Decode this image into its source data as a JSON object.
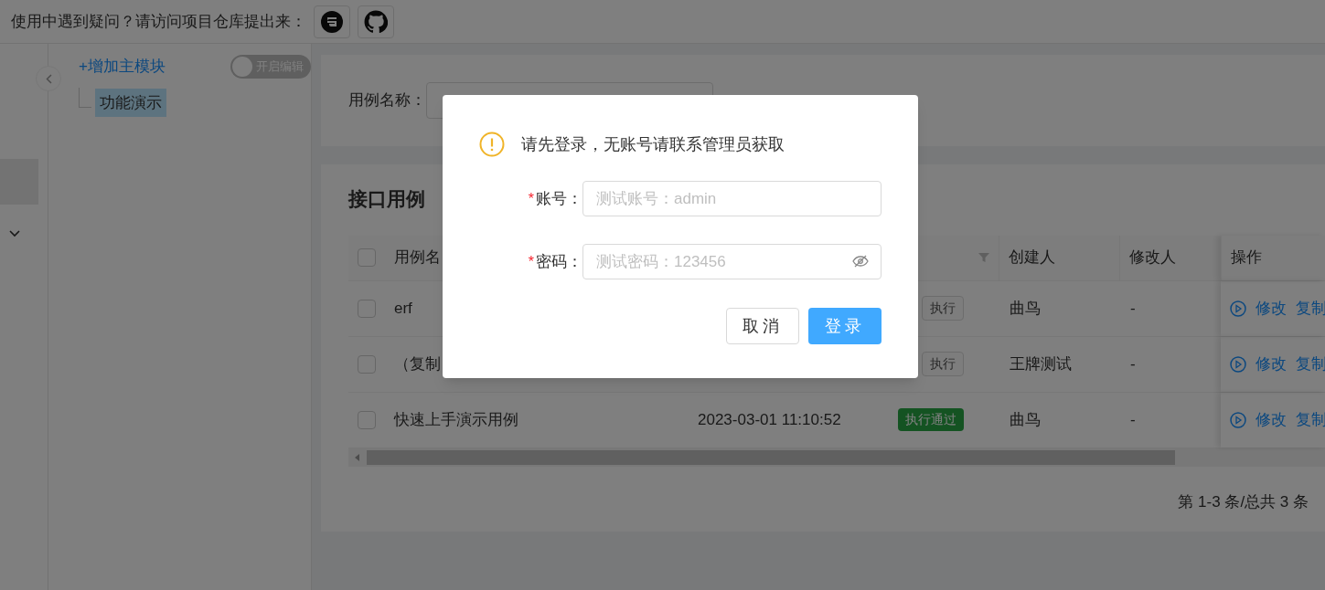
{
  "header": {
    "text": "使用中遇到疑问？请访问项目仓库提出来："
  },
  "tree": {
    "add_button": "+增加主模块",
    "edit_toggle": {
      "label": "开启编辑",
      "on": false
    },
    "nodes": [
      {
        "label": "功能演示",
        "selected": true
      }
    ]
  },
  "search": {
    "label": "用例名称："
  },
  "table": {
    "title": "接口用例",
    "all_checked": false,
    "columns": [
      {
        "label": "用例名"
      },
      {},
      {
        "filter": true
      },
      {
        "label": "创建人"
      },
      {
        "label": "修改人"
      },
      {
        "label": "操作"
      }
    ],
    "rows": [
      {
        "checked": false,
        "name": "erf",
        "status": {
          "label": "执行",
          "kind": "pending"
        },
        "creator": "曲鸟",
        "modifier": "-",
        "actions": [
          "修改",
          "复制"
        ]
      },
      {
        "checked": false,
        "name": "（复制",
        "status": {
          "label": "执行",
          "kind": "pending"
        },
        "creator": "王牌测试",
        "modifier": "-",
        "actions": [
          "修改",
          "复制"
        ]
      },
      {
        "checked": false,
        "name": "快速上手演示用例",
        "time": "2023-03-01 11:10:52",
        "status": {
          "label": "执行通过",
          "kind": "passed"
        },
        "creator": "曲鸟",
        "modifier": "-",
        "actions": [
          "修改",
          "复制"
        ]
      }
    ],
    "pagination": "第 1-3 条/总共 3 条"
  },
  "dialog": {
    "message": "请先登录，无账号请联系管理员获取",
    "fields": [
      {
        "label": "账号：",
        "required_mark": "*",
        "placeholder": "测试账号：admin",
        "kind": "text"
      },
      {
        "label": "密码：",
        "required_mark": "*",
        "placeholder": "测试密码：123456",
        "kind": "password"
      }
    ],
    "buttons": [
      {
        "label": "取消",
        "primary": false
      },
      {
        "label": "登录",
        "primary": true
      }
    ]
  }
}
